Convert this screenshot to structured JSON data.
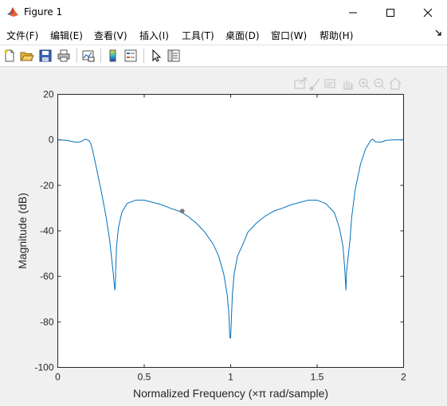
{
  "window": {
    "title": "Figure 1"
  },
  "menu": {
    "items": [
      "文件(F)",
      "编辑(E)",
      "查看(V)",
      "插入(I)",
      "工具(T)",
      "桌面(D)",
      "窗口(W)",
      "帮助(H)"
    ]
  },
  "toolbar": {
    "icons": [
      "new-figure-icon",
      "open-file-icon",
      "save-icon",
      "print-icon",
      "link-plot-icon",
      "colorbar-icon",
      "legend-icon",
      "edit-plot-icon",
      "property-inspector-icon"
    ]
  },
  "axes_toolbar": {
    "icons": [
      "export-icon",
      "brush-icon",
      "data-tips-icon",
      "pan-icon",
      "zoom-in-icon",
      "zoom-out-icon",
      "home-icon"
    ]
  },
  "chart_data": {
    "type": "line",
    "title": "",
    "xlabel": "Normalized Frequency  (×π rad/sample)",
    "ylabel": "Magnitude (dB)",
    "xlim": [
      0,
      2
    ],
    "ylim": [
      -100,
      20
    ],
    "xticks": [
      "0",
      "0.5",
      "1",
      "1.5",
      "2"
    ],
    "yticks": [
      "20",
      "0",
      "-20",
      "-40",
      "-60",
      "-80",
      "-100"
    ],
    "grid": false,
    "series": [
      {
        "color": "#0072bd",
        "x": [
          0,
          0.05,
          0.1,
          0.13,
          0.16,
          0.18,
          0.19,
          0.2,
          0.22,
          0.25,
          0.28,
          0.3,
          0.31,
          0.32,
          0.33,
          0.3333,
          0.335,
          0.34,
          0.35,
          0.37,
          0.4,
          0.45,
          0.5,
          0.55,
          0.6,
          0.65,
          0.7,
          0.72,
          0.75,
          0.8,
          0.85,
          0.9,
          0.93,
          0.96,
          0.98,
          0.99,
          0.995,
          1.0,
          1.005,
          1.01,
          1.02,
          1.04,
          1.07,
          1.1,
          1.15,
          1.2,
          1.25,
          1.3,
          1.35,
          1.4,
          1.45,
          1.5,
          1.55,
          1.6,
          1.63,
          1.65,
          1.66,
          1.665,
          1.6667,
          1.67,
          1.68,
          1.69,
          1.7,
          1.72,
          1.75,
          1.78,
          1.8,
          1.81,
          1.82,
          1.84,
          1.87,
          1.9,
          1.95,
          2.0
        ],
        "y": [
          0,
          -0.2,
          -1,
          -0.9,
          0.3,
          -0.3,
          -1.5,
          -4,
          -11,
          -22,
          -34,
          -44,
          -51,
          -58,
          -66,
          -64,
          -57,
          -47,
          -39,
          -32,
          -28,
          -26.5,
          -26.5,
          -27.5,
          -28.5,
          -30,
          -31.3,
          -32,
          -33.5,
          -36.5,
          -40.5,
          -46,
          -51,
          -59,
          -68,
          -77,
          -87,
          -87,
          -77,
          -68,
          -59,
          -51,
          -46,
          -40.5,
          -36.5,
          -33.5,
          -31.3,
          -30,
          -28.5,
          -27.5,
          -26.5,
          -26.5,
          -28,
          -32,
          -39,
          -47,
          -57,
          -64,
          -66,
          -58,
          -51,
          -44,
          -34,
          -22,
          -11,
          -4,
          -1.5,
          -0.3,
          0.3,
          -0.9,
          -1,
          -0.2,
          0,
          0
        ]
      }
    ],
    "marker": {
      "x": 0.72,
      "y": -31.3
    }
  }
}
